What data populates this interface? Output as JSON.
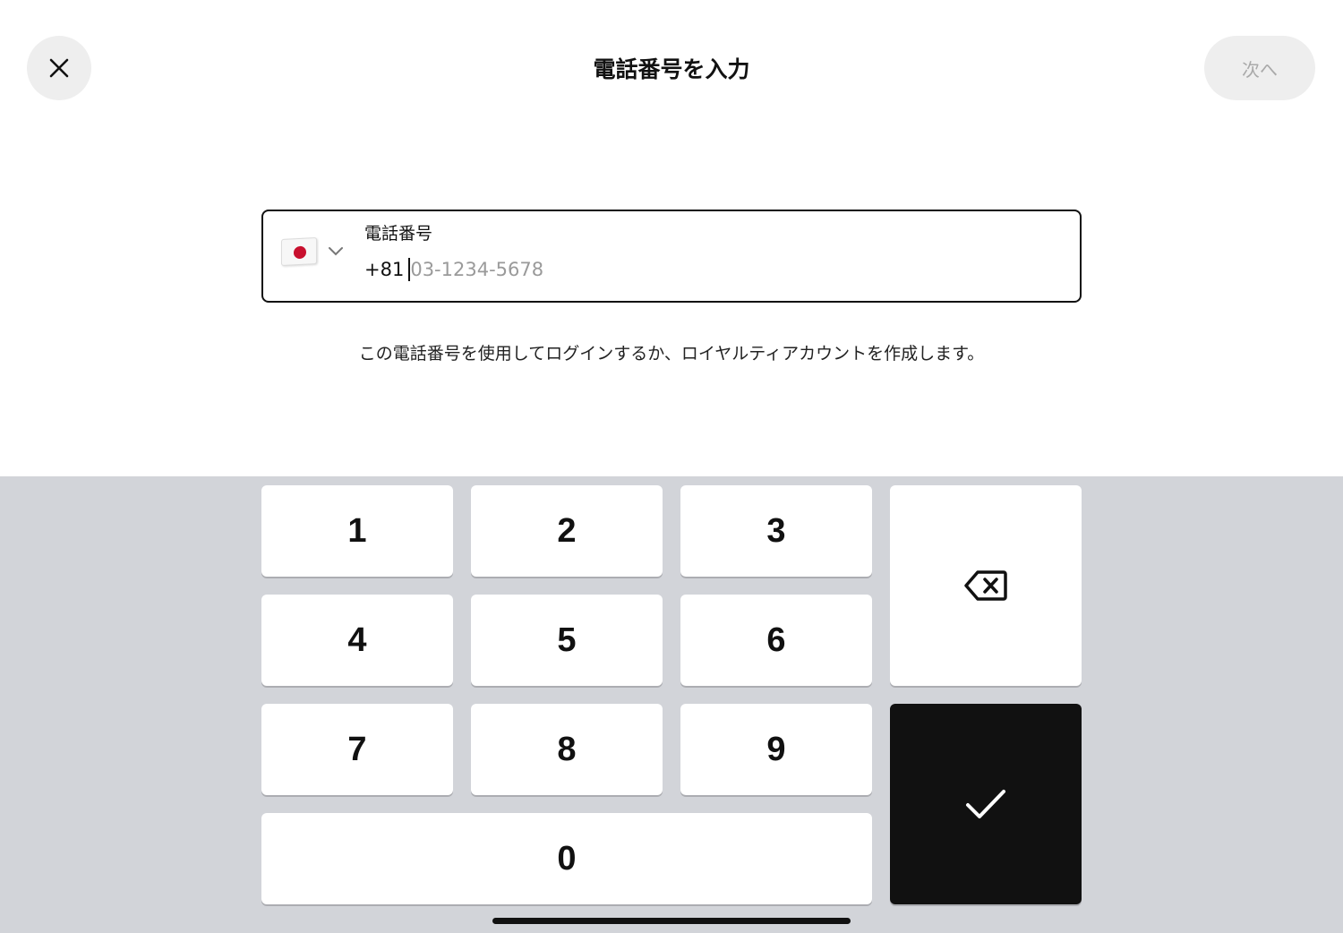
{
  "header": {
    "title": "電話番号を入力",
    "close_icon": "close-icon",
    "next_label": "次へ"
  },
  "phone_field": {
    "country_flag": "flag-japan-icon",
    "label": "電話番号",
    "country_code": "+81",
    "placeholder": "03-1234-5678"
  },
  "helper_text": "この電話番号を使用してログインするか、ロイヤルティアカウントを作成します。",
  "keypad": {
    "keys": [
      "1",
      "2",
      "3",
      "4",
      "5",
      "6",
      "7",
      "8",
      "9",
      "0"
    ],
    "backspace_icon": "backspace-icon",
    "confirm_icon": "checkmark-icon"
  },
  "colors": {
    "background": "#ffffff",
    "keypad_background": "#d2d4d9",
    "confirm_key": "#111111",
    "disabled_text": "#a9a9a9"
  }
}
